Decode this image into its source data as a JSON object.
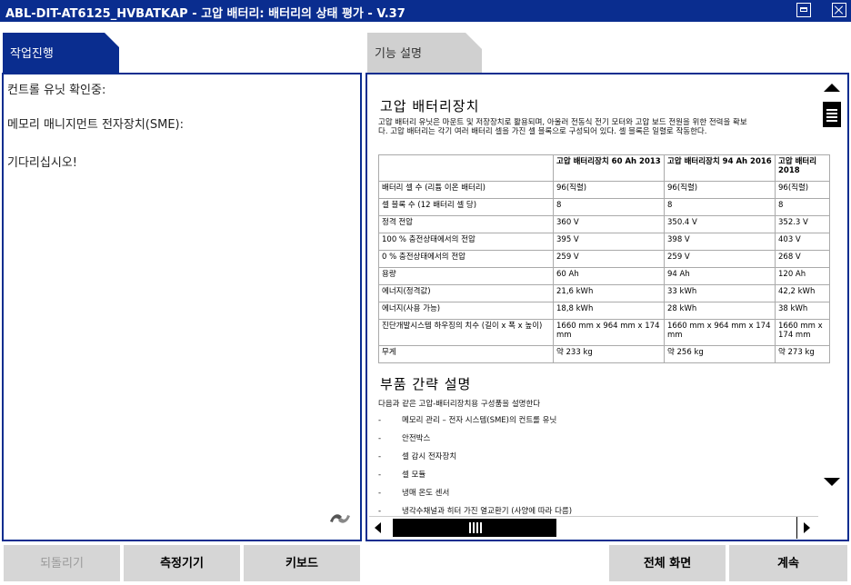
{
  "window": {
    "title": "ABL-DIT-AT6125_HVBATKAP - 고압 배터리: 배터리의 상태 평가 - V.37"
  },
  "tabs": {
    "left": "작업진행",
    "right": "기능 설명"
  },
  "progress_panel": {
    "lines": [
      "컨트롤 유닛 확인중:",
      "메모리 매니지먼트 전자장치(SME):",
      "기다리십시오!"
    ]
  },
  "doc": {
    "heading1": "고압 배터리장치",
    "intro_line1": "고압 배터리 유닛은 마운트 및 저장장치로 활용되며, 아울러 전동식 전기 모터와 고압 보드 전원을 위한 전력을 확보",
    "intro_line2": "다. 고압 배터리는 각기 여러 배터리 셀을 가진 셀 블록으로 구성되어 있다. 셀 블록은 일렬로 작동한다.",
    "table": {
      "headers": [
        "",
        "고압 배터리장치 60 Ah 2013",
        "고압 배터리장치 94 Ah 2016",
        "고압 배터리 2018"
      ],
      "rows": [
        [
          "배터리 셀 수 (리튬 이온 배터리)",
          "96(직렬)",
          "96(직렬)",
          "96(직렬)"
        ],
        [
          "셀 블록 수 (12 배터리 셀 당)",
          "8",
          "8",
          "8"
        ],
        [
          "정격 전압",
          "360 V",
          "350.4 V",
          "352.3 V"
        ],
        [
          "100 % 충전상태에서의 전압",
          "395 V",
          "398 V",
          "403 V"
        ],
        [
          "0 % 충전상태에서의 전압",
          "259 V",
          "259 V",
          "268 V"
        ],
        [
          "용량",
          "60 Ah",
          "94 Ah",
          "120 Ah"
        ],
        [
          "에너지(정격값)",
          "21,6 kWh",
          "33 kWh",
          "42,2 kWh"
        ],
        [
          "에너지(사용 가능)",
          "18,8 kWh",
          "28 kWh",
          "38 kWh"
        ],
        [
          "진단개발시스템 하우징의 치수 (길이 x 폭 x 높이)",
          "1660 mm x 964 mm x 174 mm",
          "1660 mm x 964 mm x 174 mm",
          "1660 mm x 174 mm"
        ],
        [
          "무게",
          "약 233 kg",
          "약 256 kg",
          "약 273 kg"
        ]
      ]
    },
    "heading2": "부품 간략 설명",
    "components_intro": "다음과 같은 고압-배터리장치용 구성품을 설명한다",
    "components": [
      "메모리 관리 – 전자 시스템(SME)의 컨트롤 유닛",
      "안전박스",
      "셀 감시 전자장치",
      "셀 모듈",
      "냉매 온도 센서",
      "냉각수채널과 히터 가진 열교환기 (사양에 따라 다름)"
    ],
    "bullet": "-"
  },
  "buttons": {
    "back": "되돌리기",
    "measure": "측정기기",
    "keyboard": "키보드",
    "fullscreen": "전체 화면",
    "continue": "계속"
  },
  "colors": {
    "accent": "#0a2d8f",
    "button_bg": "#d6d6d6"
  }
}
